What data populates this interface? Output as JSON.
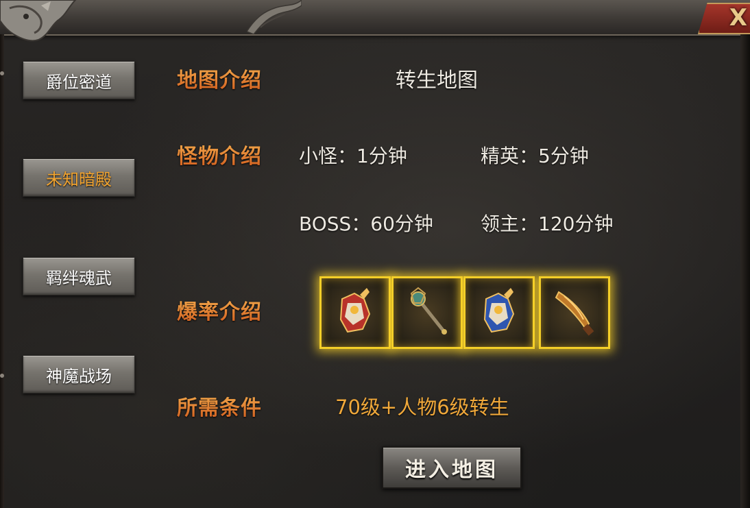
{
  "close_label": "X",
  "tabs": [
    {
      "label": "爵位密道",
      "active": false
    },
    {
      "label": "未知暗殿",
      "active": true
    },
    {
      "label": "羁绊魂武",
      "active": false
    },
    {
      "label": "神魔战场",
      "active": false
    }
  ],
  "map_intro": {
    "label": "地图介绍",
    "value": "转生地图"
  },
  "monster_intro": {
    "label": "怪物介绍",
    "minion": "小怪：1分钟",
    "elite": "精英：5分钟",
    "boss": "BOSS：60分钟",
    "lord": "领主：120分钟"
  },
  "drop_intro": {
    "label": "爆率介绍",
    "items": [
      {
        "icon": "red-armor-icon"
      },
      {
        "icon": "staff-weapon-icon"
      },
      {
        "icon": "blue-armor-icon"
      },
      {
        "icon": "blade-weapon-icon"
      }
    ]
  },
  "requirement": {
    "label": "所需条件",
    "value": "70级+人物6级转生"
  },
  "enter_button": "进入地图",
  "colors": {
    "active_tab": "#f2a430",
    "label_orange": "#e07c2c",
    "slot_gold": "#f4cf28"
  }
}
